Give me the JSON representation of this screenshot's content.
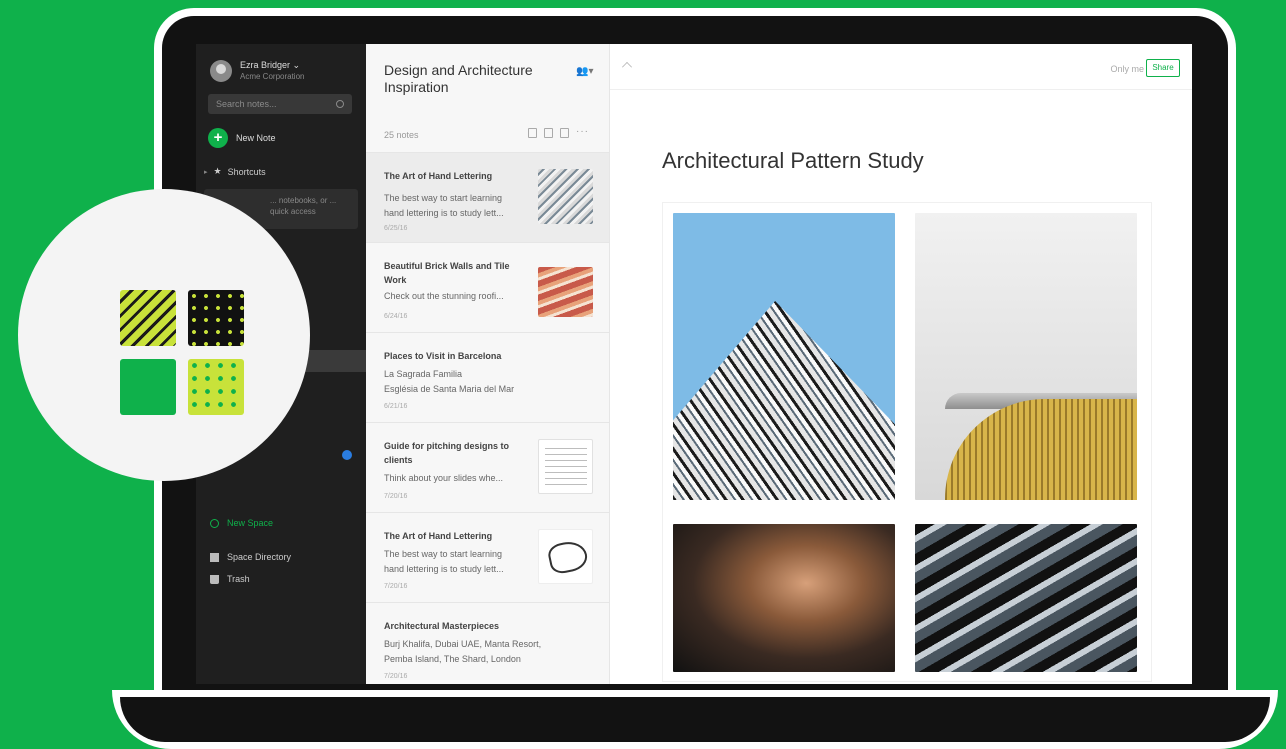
{
  "colors": {
    "brand_green": "#0fb14b",
    "sidebar_bg": "#1f1f1f",
    "accent_lime": "#c8e23a"
  },
  "sidebar": {
    "account_name": "Ezra Bridger ⌄",
    "account_org": "Acme Corporation",
    "search_placeholder": "Search notes...",
    "new_note_label": "New Note",
    "shortcuts_label": "Shortcuts",
    "shortcuts_hint": "... notebooks, or ... quick access",
    "new_space_label": "New Space",
    "space_directory_label": "Space Directory",
    "trash_label": "Trash"
  },
  "notelist": {
    "title": "Design and Architecture Inspiration",
    "count": "25 notes",
    "notes": [
      {
        "title": "The Art of Hand Lettering",
        "body1": "The best way to start learning",
        "body2": "hand lettering is to study lett...",
        "date": "6/25/16",
        "thumb": "building"
      },
      {
        "title": "Beautiful Brick Walls and Tile Work",
        "body1": "Check out the stunning roofi...",
        "body2": "",
        "date": "6/24/16",
        "thumb": "brick"
      },
      {
        "title": "Places to Visit in Barcelona",
        "body1": "La Sagrada Familia",
        "body2": "Església de Santa Maria del Mar",
        "date": "6/21/16",
        "thumb": ""
      },
      {
        "title": "Guide for pitching designs to clients",
        "body1": "Think about your slides whe...",
        "body2": "",
        "date": "7/20/16",
        "thumb": "document"
      },
      {
        "title": "The Art of Hand Lettering",
        "body1": "The best way to start learning",
        "body2": "hand lettering is to study lett...",
        "date": "7/20/16",
        "thumb": "hand-lettering"
      },
      {
        "title": "Architectural Masterpieces",
        "body1": "Burj Khalifa, Dubai UAE, Manta Resort,",
        "body2": "Pemba Island, The Shard, London",
        "date": "7/20/16",
        "thumb": ""
      }
    ]
  },
  "editor": {
    "only_you": "Only me",
    "share_label": "Share",
    "note_title": "Architectural Pattern Study"
  }
}
